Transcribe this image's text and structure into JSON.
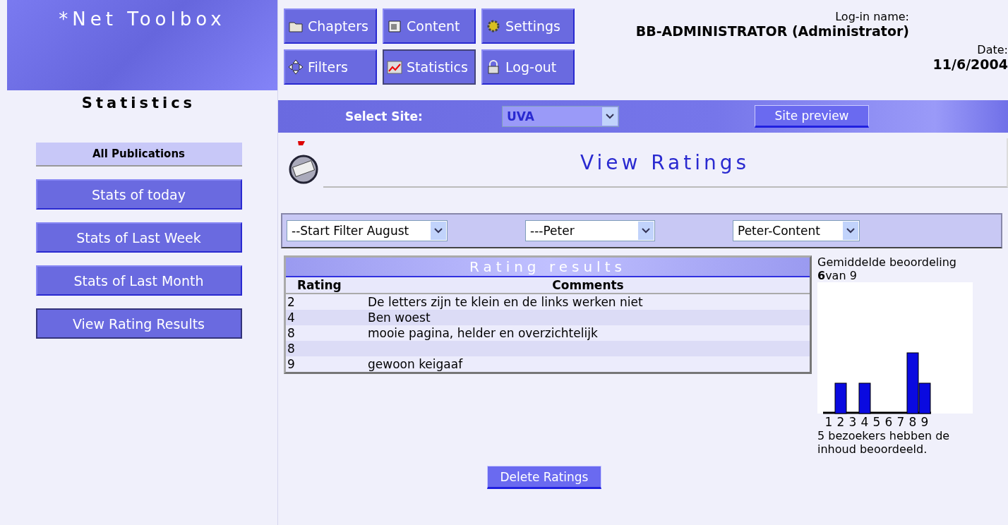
{
  "brand": "*Net Toolbox",
  "section_title": "Statistics",
  "sidebar": {
    "heading": "All Publications",
    "items": [
      {
        "label": "Stats of today",
        "selected": false
      },
      {
        "label": "Stats of Last Week",
        "selected": false
      },
      {
        "label": "Stats of Last Month",
        "selected": false
      },
      {
        "label": "View Rating Results",
        "selected": true
      }
    ]
  },
  "nav": [
    {
      "label": "Chapters",
      "kind": "folder",
      "selected": false
    },
    {
      "label": "Content",
      "kind": "document",
      "selected": false
    },
    {
      "label": "Settings",
      "kind": "gear",
      "selected": false
    },
    {
      "label": "Filters",
      "kind": "arrows",
      "selected": false
    },
    {
      "label": "Statistics",
      "kind": "chart",
      "selected": true
    },
    {
      "label": "Log-out",
      "kind": "lock",
      "selected": false
    }
  ],
  "login": {
    "label": "Log-in name:",
    "value": "BB-ADMINISTRATOR (Administrator)"
  },
  "date": {
    "label": "Date:",
    "value": "11/6/2004"
  },
  "site_bar": {
    "label": "Select Site:",
    "site": "UVA",
    "preview_button": "Site preview"
  },
  "page_title": "View Ratings",
  "filters": [
    "--Start Filter August",
    "---Peter",
    "Peter-Content"
  ],
  "table": {
    "title": "Rating results",
    "columns": [
      "Rating",
      "Comments"
    ],
    "rows": [
      [
        "2",
        "De letters zijn te klein en de links werken niet"
      ],
      [
        "4",
        "Ben woest"
      ],
      [
        "8",
        "mooie pagina, helder en overzichtelijk"
      ],
      [
        "8",
        ""
      ],
      [
        "9",
        "gewoon keigaaf"
      ]
    ]
  },
  "summary": {
    "average_label": "Gemiddelde beoordeling",
    "average": "**6**van 9",
    "footer": "5 bezoekers hebben de inhoud beoordeeld.",
    "chart_labels": [
      "1",
      "2",
      "3",
      "4",
      "5",
      "6",
      "7",
      "8",
      "9"
    ]
  },
  "delete_button": "Delete Ratings"
}
